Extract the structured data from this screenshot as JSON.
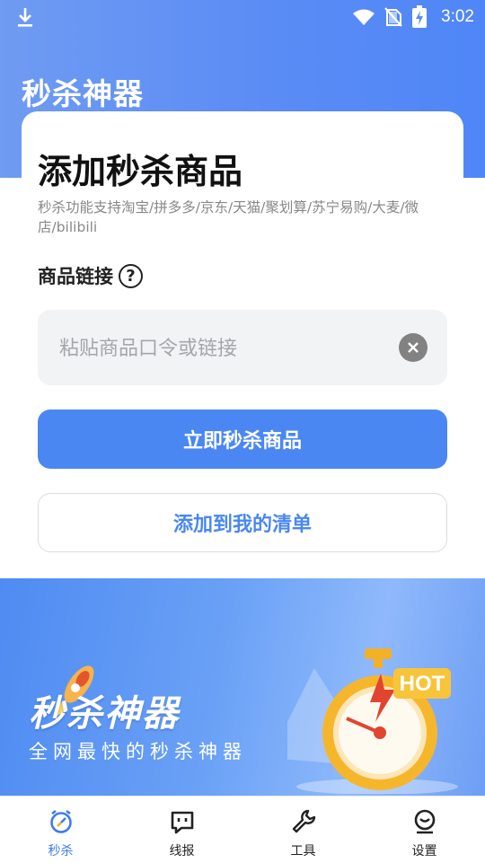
{
  "status_bar": {
    "time": "3:02",
    "icons": [
      "download-icon",
      "wifi-icon",
      "no-sim-icon",
      "battery-charging-icon"
    ]
  },
  "header": {
    "app_title": "秒杀神器"
  },
  "card": {
    "title": "添加秒杀商品",
    "support_text": "秒杀功能支持淘宝/拼多多/京东/天猫/聚划算/苏宁易购/大麦/微店/bilibili",
    "link_label": "商品链接",
    "help_icon_glyph": "?",
    "input": {
      "value": "",
      "placeholder": "粘贴商品口令或链接"
    },
    "primary_button": "立即秒杀商品",
    "secondary_button": "添加到我的清单"
  },
  "banner": {
    "title": "秒杀神器",
    "subtitle": "全网最快的秒杀神器",
    "badge": "HOT"
  },
  "tabbar": {
    "items": [
      {
        "label": "秒杀",
        "icon": "alarm-clock-icon",
        "active": true
      },
      {
        "label": "线报",
        "icon": "chat-bubble-icon",
        "active": false
      },
      {
        "label": "工具",
        "icon": "wrench-icon",
        "active": false
      },
      {
        "label": "设置",
        "icon": "smile-face-icon",
        "active": false
      }
    ]
  },
  "colors": {
    "accent": "#4a87f3",
    "active_tab": "#3d7bf0",
    "header_start": "#6f9bf2",
    "header_end": "#4f86f7"
  }
}
